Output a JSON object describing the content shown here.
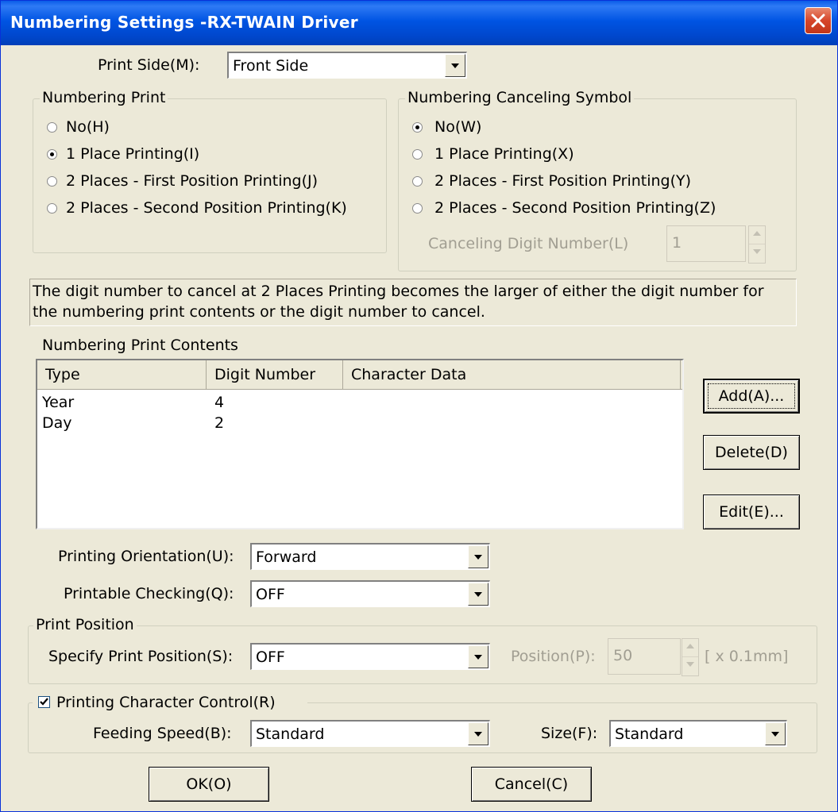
{
  "window": {
    "title": "Numbering Settings -RX-TWAIN Driver"
  },
  "print_side": {
    "label": "Print Side(M):",
    "value": "Front Side"
  },
  "numbering_print": {
    "title": "Numbering Print",
    "options": [
      "No(H)",
      "1 Place Printing(I)",
      "2 Places - First Position Printing(J)",
      "2 Places - Second Position Printing(K)"
    ],
    "selected": 1
  },
  "canceling_symbol": {
    "title": "Numbering Canceling Symbol",
    "options": [
      "No(W)",
      "1 Place Printing(X)",
      "2 Places - First Position Printing(Y)",
      "2 Places - Second Position Printing(Z)"
    ],
    "selected": 0,
    "digit_label": "Canceling Digit Number(L)",
    "digit_value": "1"
  },
  "info_text_line1": "The digit number to cancel at 2 Places Printing becomes the larger of either the digit number for",
  "info_text_line2": "the numbering print contents or the digit number to cancel.",
  "contents": {
    "label": "Numbering Print Contents",
    "columns": [
      "Type",
      "Digit Number",
      "Character Data"
    ],
    "rows": [
      {
        "type": "Year",
        "digits": "4",
        "data": ""
      },
      {
        "type": "Day",
        "digits": "2",
        "data": ""
      }
    ]
  },
  "buttons": {
    "add": "Add(A)...",
    "delete": "Delete(D)",
    "edit": "Edit(E)...",
    "ok": "OK(O)",
    "cancel": "Cancel(C)"
  },
  "orientation": {
    "label": "Printing Orientation(U):",
    "value": "Forward"
  },
  "checking": {
    "label": "Printable Checking(Q):",
    "value": "OFF"
  },
  "print_position": {
    "title": "Print Position",
    "specify_label": "Specify Print Position(S):",
    "specify_value": "OFF",
    "position_label": "Position(P):",
    "position_value": "50",
    "unit": "[ x 0.1mm]"
  },
  "char_control": {
    "title": "Printing Character Control(R)",
    "checked": true,
    "speed_label": "Feeding Speed(B):",
    "speed_value": "Standard",
    "size_label": "Size(F):",
    "size_value": "Standard"
  }
}
